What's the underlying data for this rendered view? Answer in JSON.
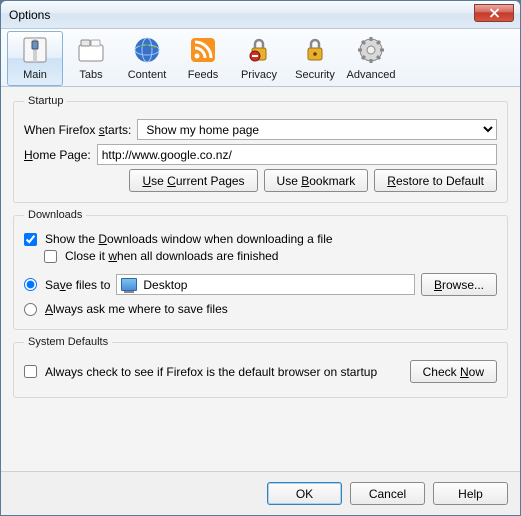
{
  "window": {
    "title": "Options"
  },
  "tabs": {
    "main": "Main",
    "tabs": "Tabs",
    "content": "Content",
    "feeds": "Feeds",
    "privacy": "Privacy",
    "security": "Security",
    "advanced": "Advanced"
  },
  "startup": {
    "legend": "Startup",
    "when_label_pre": "When Firefox ",
    "when_label_u": "s",
    "when_label_post": "tarts:",
    "when_value": "Show my home page",
    "home_label_u": "H",
    "home_label_post": "ome Page:",
    "home_value": "http://www.google.co.nz/",
    "use_current": "Use Current Pages",
    "use_bookmark": "Use Bookmark",
    "restore": "Restore to Default"
  },
  "downloads": {
    "legend": "Downloads",
    "show_pre": "Show the ",
    "show_u": "D",
    "show_post": "ownloads window when downloading a file",
    "close_pre": "Close it ",
    "close_u": "w",
    "close_post": "hen all downloads are finished",
    "save_pre": "Sa",
    "save_u": "v",
    "save_post": "e files to",
    "save_loc": "Desktop",
    "browse_u": "B",
    "browse_post": "rowse...",
    "always_u": "A",
    "always_post": "lways ask me where to save files"
  },
  "sysdef": {
    "legend": "System Defaults",
    "check_text": "Always check to see if Firefox is the default browser on startup",
    "check_btn_pre": "Check ",
    "check_btn_u": "N",
    "check_btn_post": "ow"
  },
  "footer": {
    "ok": "OK",
    "cancel": "Cancel",
    "help": "Help"
  }
}
